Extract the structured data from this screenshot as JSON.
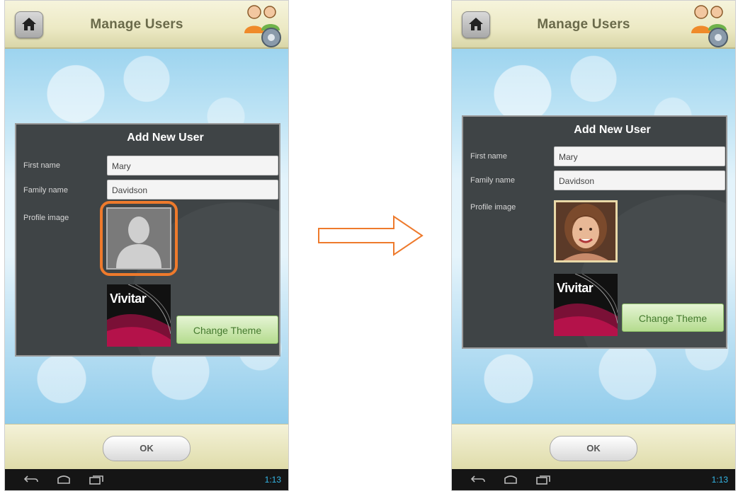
{
  "screens": [
    {
      "header": {
        "title": "Manage Users"
      },
      "dialog": {
        "title": "Add New User",
        "first_name_label": "First name",
        "first_name_value": "Mary",
        "family_name_label": "Family name",
        "family_name_value": "Davidson",
        "profile_image_label": "Profile image",
        "profile_image_state": "placeholder",
        "theme_brand": "Vivitar",
        "change_theme_label": "Change Theme"
      },
      "footer": {
        "ok_label": "OK"
      },
      "status_bar": {
        "time": "1:13"
      }
    },
    {
      "header": {
        "title": "Manage Users"
      },
      "dialog": {
        "title": "Add New User",
        "first_name_label": "First name",
        "first_name_value": "Mary",
        "family_name_label": "Family name",
        "family_name_value": "Davidson",
        "profile_image_label": "Profile image",
        "profile_image_state": "photo",
        "theme_brand": "Vivitar",
        "change_theme_label": "Change Theme"
      },
      "footer": {
        "ok_label": "OK"
      },
      "status_bar": {
        "time": "1:13"
      }
    }
  ],
  "colors": {
    "highlight": "#ee7a2c",
    "arrow": "#ee7a2c",
    "panel_bg": "#3f4446",
    "theme_button": "#b5dc8f",
    "clock": "#35b8e8"
  },
  "icons": [
    "home-icon",
    "users-settings-icon",
    "person-silhouette-icon",
    "back-icon",
    "home-nav-icon",
    "recent-apps-icon",
    "right-arrow-icon"
  ]
}
